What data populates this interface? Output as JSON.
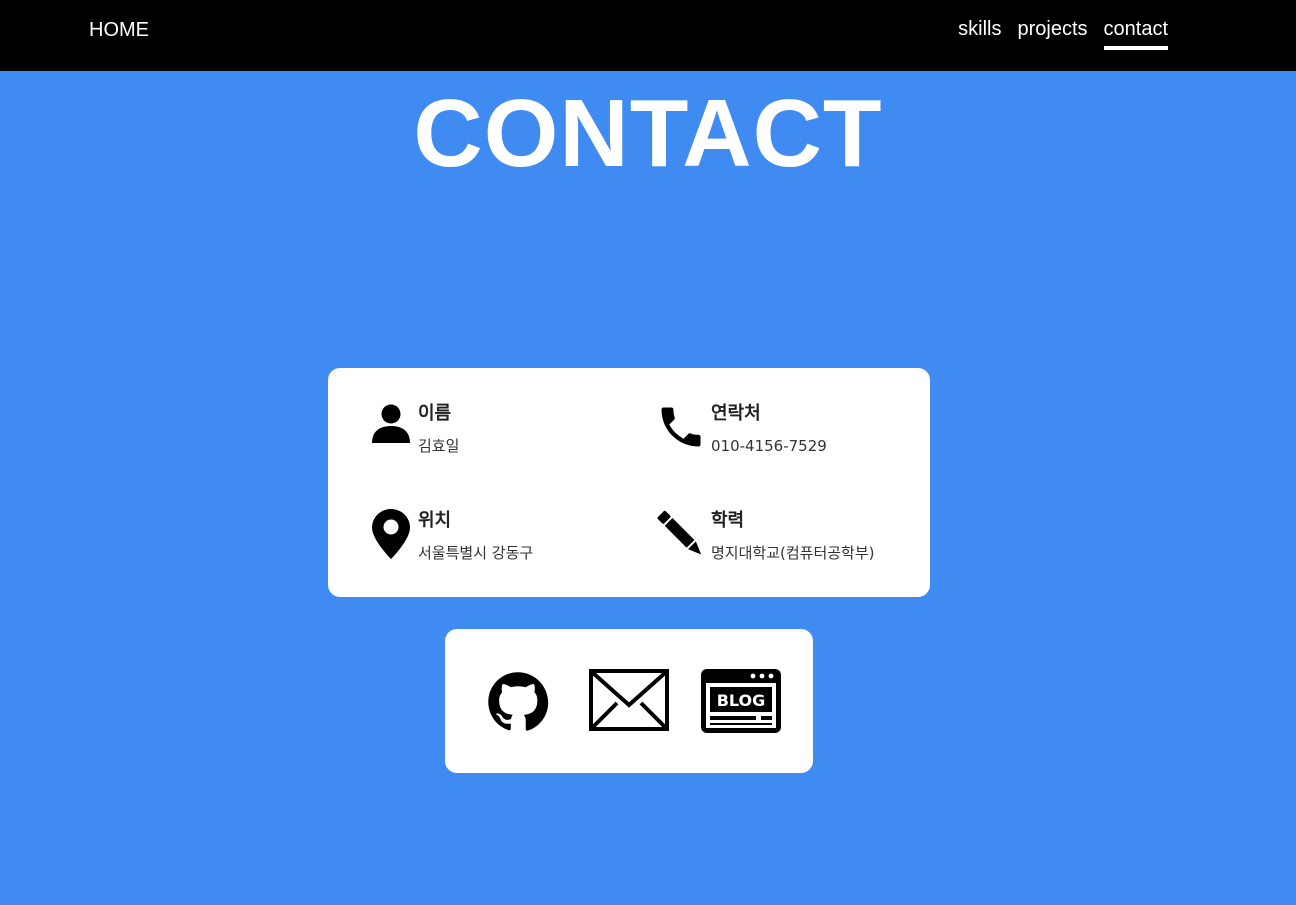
{
  "nav": {
    "home": "HOME",
    "links": [
      {
        "label": "skills",
        "active": false
      },
      {
        "label": "projects",
        "active": false
      },
      {
        "label": "contact",
        "active": true
      }
    ]
  },
  "page": {
    "title": "CONTACT"
  },
  "info": [
    {
      "icon": "person-icon",
      "label": "이름",
      "value": "김효일"
    },
    {
      "icon": "phone-icon",
      "label": "연락처",
      "value": "010-4156-7529"
    },
    {
      "icon": "map-pin-icon",
      "label": "위치",
      "value": "서울특별시 강동구"
    },
    {
      "icon": "pencil-icon",
      "label": "학력",
      "value": "명지대학교(컴퓨터공학부)"
    }
  ],
  "links": [
    {
      "icon": "github-icon"
    },
    {
      "icon": "mail-icon"
    },
    {
      "icon": "blog-icon",
      "text": "BLOG"
    }
  ],
  "colors": {
    "background": "#3f8bf1",
    "navbar": "#000000",
    "card": "#ffffff",
    "text": "#222222"
  }
}
